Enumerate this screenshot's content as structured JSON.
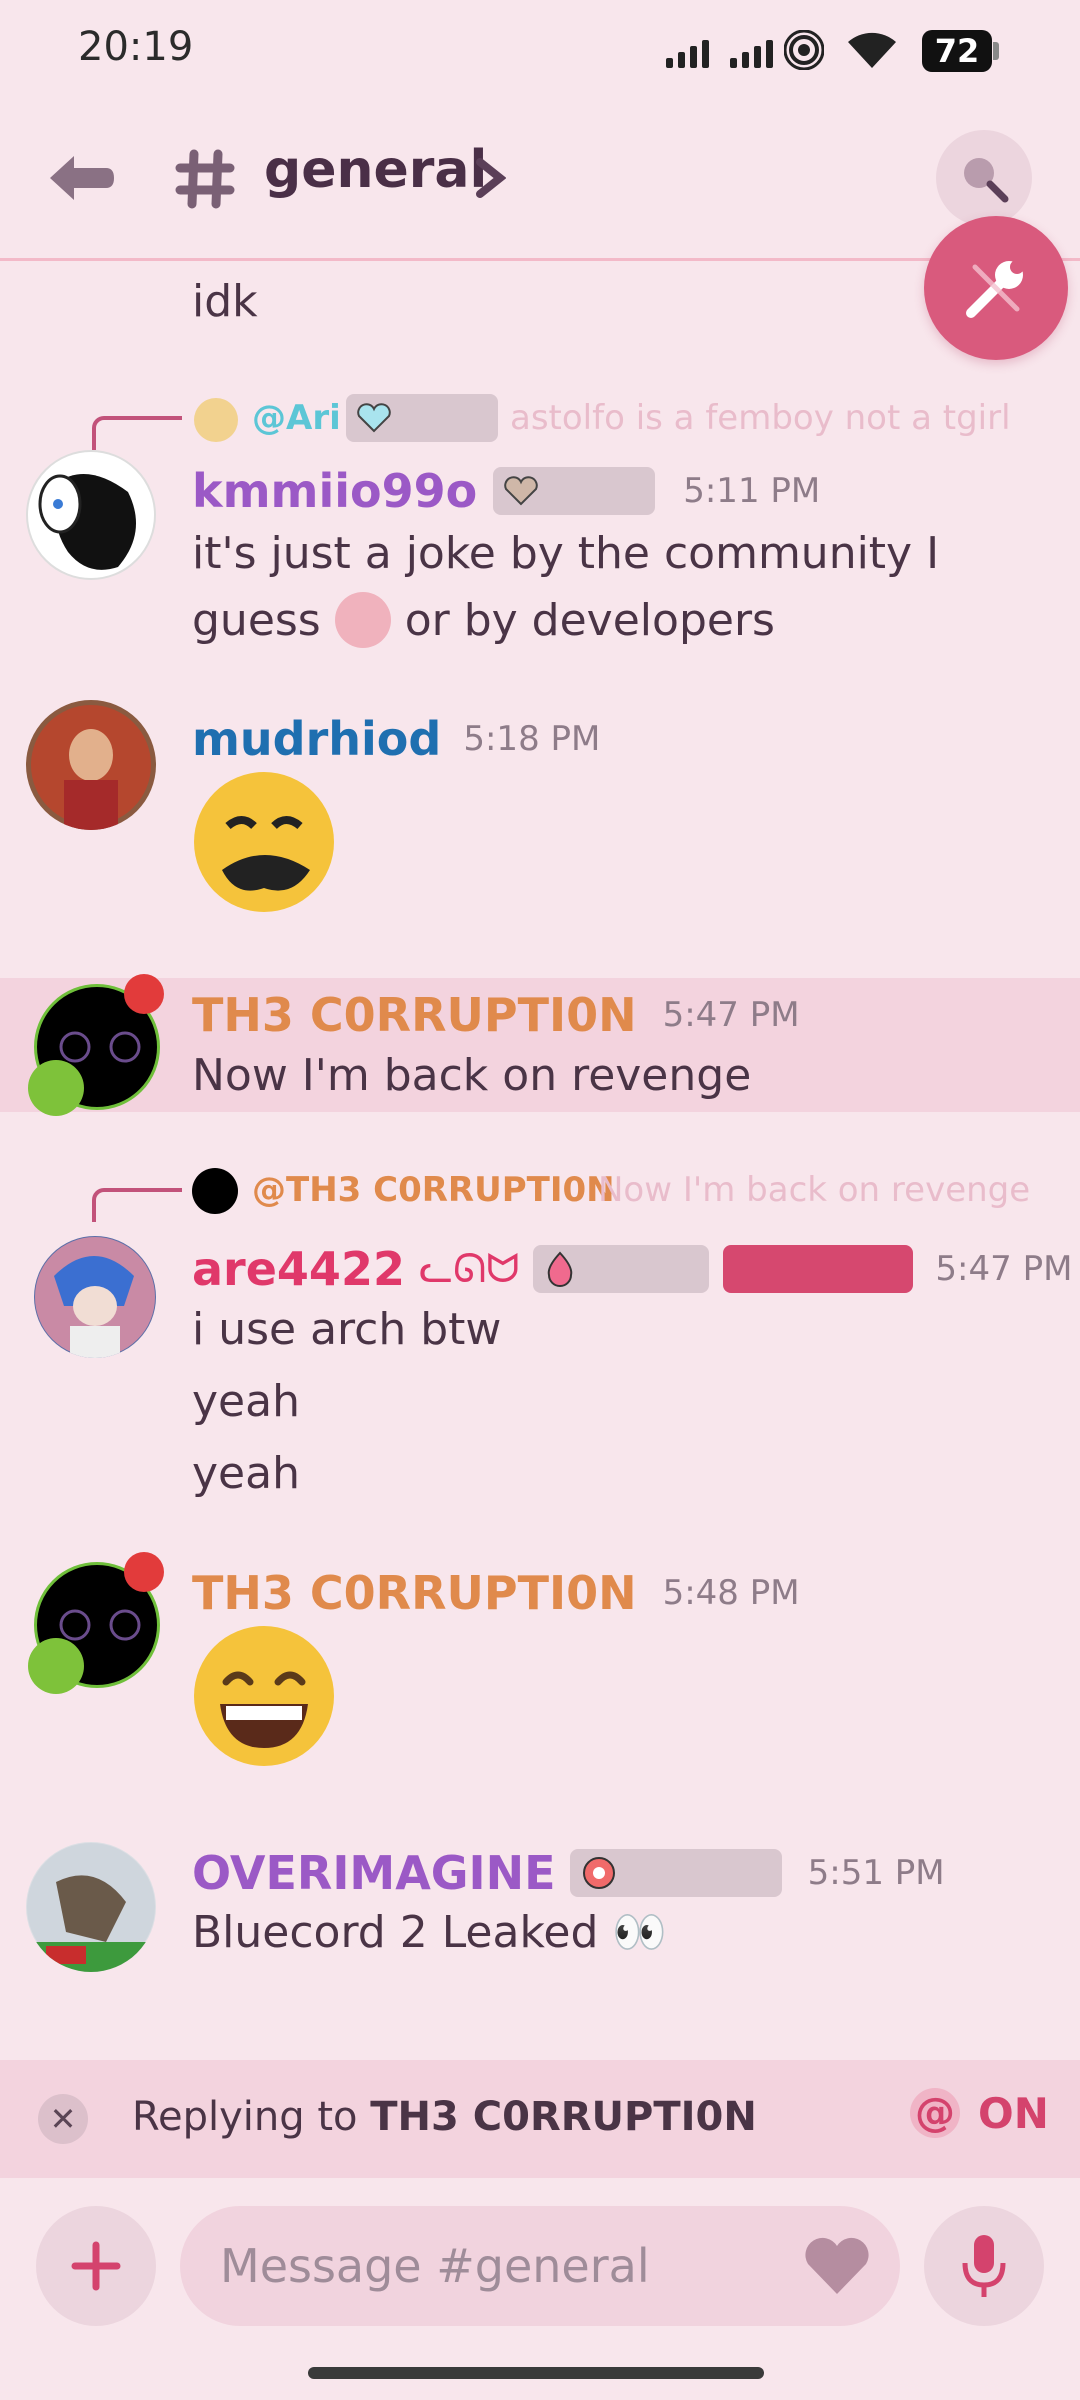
{
  "status_bar": {
    "time": "20:19",
    "battery": "72"
  },
  "header": {
    "channel_name": "general"
  },
  "messages": [
    {
      "text": "idk"
    },
    {
      "reply_to": {
        "name": "@Ari",
        "text": "astolfo is a femboy not a tgirl",
        "name_color": "#5cc6d6"
      },
      "username": "kmmiio99o",
      "username_color": "#9b59c6",
      "time": "5:11 PM",
      "lines": [
        "it's just a joke by the community I",
        "guess",
        "or by developers"
      ]
    },
    {
      "username": "mudrhiod",
      "username_color": "#1f6fb0",
      "time": "5:18 PM",
      "emoji": "sad-bearded-face"
    },
    {
      "username": "TH3 C0RRUPTI0N",
      "username_color": "#e08a4c",
      "time": "5:47 PM",
      "lines": [
        "Now I'm back on revenge"
      ]
    },
    {
      "reply_to": {
        "name": "@TH3 C0RRUPTI0N",
        "text": "Now I'm back on revenge",
        "name_color": "#e08a4c"
      },
      "username": "are4422",
      "username_suffix": "ᓚᘏᗢ",
      "username_color": "#e0386a",
      "time": "5:47 PM",
      "lines": [
        "i use arch btw",
        "yeah",
        "yeah"
      ]
    },
    {
      "username": "TH3 C0RRUPTI0N",
      "username_color": "#e08a4c",
      "time": "5:48 PM",
      "emoji": "grinning-face"
    },
    {
      "username": "OVERIMAGINE",
      "username_color": "#9b59c6",
      "time": "5:51 PM",
      "lines": [
        "Bluecord 2 Leaked 👀"
      ]
    }
  ],
  "reply_bar": {
    "prefix": "Replying to",
    "target": "TH3 C0RRUPTI0N",
    "mention_state": "ON"
  },
  "composer": {
    "placeholder": "Message #general"
  },
  "colors": {
    "accent": "#d95a7d",
    "background": "#f8e6ec",
    "highlight": "#f3d3de"
  }
}
